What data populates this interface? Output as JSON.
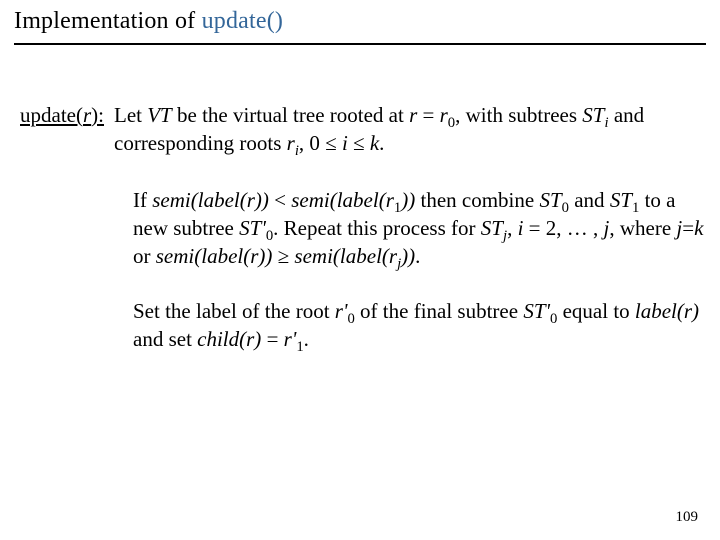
{
  "title": {
    "plain": "Implementation of ",
    "accent": "update()"
  },
  "def": {
    "lhs_plain": "update(",
    "lhs_ital": "r",
    "lhs_after": "):",
    "rhs_html": "Let  <em class='m'>VT</em>  be the virtual tree rooted at  <em class='m'>r</em> = <em class='m'>r</em><sub>0</sub>, with subtrees  <em class='m'>ST<sub>i</sub></em>  and corresponding roots  <em class='m'>r<sub>i</sub></em>, 0 ≤ <em class='m'>i</em> ≤ <em class='m'>k</em>."
  },
  "para1_html": "If  <em class='m'>semi(label(r))</em> < <em class='m'>semi(label(r</em><sub>1</sub><em class='m'>))</em>  then combine <em class='m'>ST</em><sub>0</sub> and  <em class='m'>ST</em><sub>1</sub>  to a new subtree  <em class='m'>ST'</em><sub>0</sub>. Repeat this process for  <em class='m'>ST<sub>j</sub></em>, <em class='m'>i</em> = 2, … , <em class='m'>j</em>,  where  <em class='m'>j</em>=<em class='m'>k</em>  or <em class='m'>semi(label(r))</em> ≥ <em class='m'>semi(label(r<sub>j</sub>))</em>.",
  "para2_html": "Set the label of the root  <em class='m'>r'</em><sub>0</sub>  of the final subtree  <em class='m'>ST'</em><sub>0</sub> equal to  <em class='m'>label(r)</em>  and set  <em class='m'>child(r)</em> = <em class='m'>r'</em><sub>1</sub>.",
  "pagenum": "109"
}
